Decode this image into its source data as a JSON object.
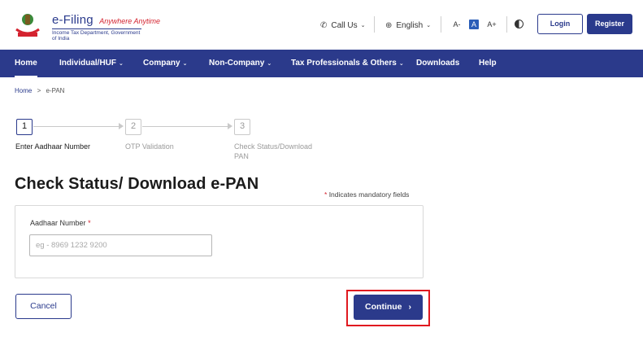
{
  "header": {
    "brand_title": "e-Filing",
    "brand_tagline": "Anywhere Anytime",
    "brand_subtitle": "Income Tax Department, Government of India",
    "call_us": "Call Us",
    "language": "English",
    "font_decrease": "A-",
    "font_normal": "A",
    "font_increase": "A+",
    "login_label": "Login",
    "register_label": "Register"
  },
  "nav": {
    "items": [
      {
        "label": "Home",
        "has_dropdown": false
      },
      {
        "label": "Individual/HUF",
        "has_dropdown": true
      },
      {
        "label": "Company",
        "has_dropdown": true
      },
      {
        "label": "Non-Company",
        "has_dropdown": true
      },
      {
        "label": "Tax Professionals & Others",
        "has_dropdown": true
      },
      {
        "label": "Downloads",
        "has_dropdown": false
      },
      {
        "label": "Help",
        "has_dropdown": false
      }
    ]
  },
  "breadcrumb": {
    "home": "Home",
    "separator": ">",
    "current": "e-PAN"
  },
  "steps": [
    {
      "number": "1",
      "label": "Enter Aadhaar Number",
      "active": true
    },
    {
      "number": "2",
      "label": "OTP Validation",
      "active": false
    },
    {
      "number": "3",
      "label": "Check Status/Download PAN",
      "active": false
    }
  ],
  "form": {
    "title": "Check Status/ Download e-PAN",
    "mandatory_star": "*",
    "mandatory_note": "Indicates mandatory fields",
    "aadhaar_label": "Aadhaar Number",
    "aadhaar_required": "*",
    "aadhaar_placeholder": "eg - 8969 1232 9200",
    "aadhaar_value": ""
  },
  "actions": {
    "cancel_label": "Cancel",
    "continue_label": "Continue",
    "continue_chevron": "›"
  },
  "colors": {
    "brand_navy": "#2b3a8b",
    "accent_red": "#d4232f",
    "highlight_red": "#e0191f"
  }
}
